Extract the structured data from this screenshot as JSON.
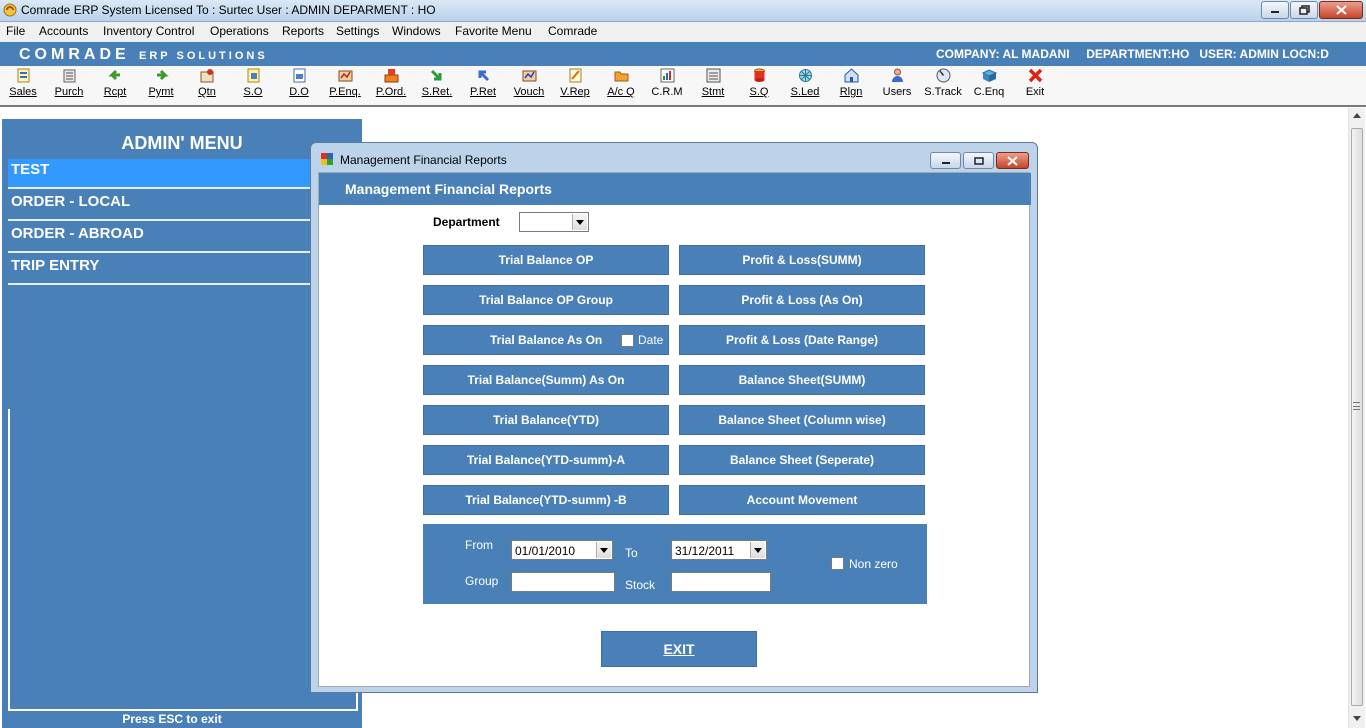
{
  "titlebar": {
    "title": "Comrade ERP System  Licensed To : Surtec  User : ADMIN  DEPARMENT : HO"
  },
  "menubar": {
    "items": [
      {
        "label": "File"
      },
      {
        "label": "Accounts"
      },
      {
        "label": "Inventory Control"
      },
      {
        "label": "Operations"
      },
      {
        "label": "Reports"
      },
      {
        "label": "Settings"
      },
      {
        "label": "Windows"
      },
      {
        "label": "Favorite Menu"
      },
      {
        "label": "Comrade"
      }
    ]
  },
  "brandbar": {
    "brand_big": "COMRADE",
    "brand_small": "ERP SOLUTIONS",
    "info": "COMPANY: AL MADANI     DEPARTMENT:HO   USER: ADMIN LOCN:D"
  },
  "toolbar": {
    "buttons": [
      {
        "label": "Sales",
        "icon": "sales-icon"
      },
      {
        "label": "Purch",
        "icon": "purchase-icon"
      },
      {
        "label": "Rcpt",
        "icon": "receipt-icon"
      },
      {
        "label": "Pymt",
        "icon": "payment-icon"
      },
      {
        "label": "Qtn",
        "icon": "quotation-icon"
      },
      {
        "label": "S.O",
        "icon": "sales-order-icon"
      },
      {
        "label": "D.O",
        "icon": "delivery-order-icon"
      },
      {
        "label": "P.Enq.",
        "icon": "purchase-enquiry-icon"
      },
      {
        "label": "P.Ord.",
        "icon": "purchase-order-icon"
      },
      {
        "label": "S.Ret.",
        "icon": "sales-return-icon"
      },
      {
        "label": "P.Ret",
        "icon": "purchase-return-icon"
      },
      {
        "label": "Vouch",
        "icon": "voucher-icon"
      },
      {
        "label": "V.Rep",
        "icon": "voucher-report-icon"
      },
      {
        "label": "A/c Q",
        "icon": "account-query-icon"
      },
      {
        "label": "C.R.M",
        "icon": "crm-icon"
      },
      {
        "label": "Stmt",
        "icon": "statement-icon"
      },
      {
        "label": "S.Q",
        "icon": "stock-query-icon"
      },
      {
        "label": "S.Led",
        "icon": "stock-ledger-icon"
      },
      {
        "label": "Rlgn",
        "icon": "relogin-icon"
      },
      {
        "label": "Users",
        "icon": "users-icon"
      },
      {
        "label": "S.Track",
        "icon": "shipment-track-icon"
      },
      {
        "label": "C.Enq",
        "icon": "customer-enquiry-icon"
      },
      {
        "label": "Exit",
        "icon": "exit-icon"
      }
    ]
  },
  "admin_menu": {
    "title": "ADMIN' MENU",
    "items": [
      {
        "label": "TEST"
      },
      {
        "label": "ORDER - LOCAL"
      },
      {
        "label": "ORDER - ABROAD"
      },
      {
        "label": "TRIP ENTRY"
      }
    ],
    "footer": "Press ESC to exit"
  },
  "dialog": {
    "window_title": "Management Financial Reports",
    "header": "Management Financial Reports",
    "department_label": "Department",
    "department_value": "",
    "left_buttons": [
      {
        "label": "Trial Balance OP"
      },
      {
        "label": "Trial Balance OP Group"
      },
      {
        "label": "Trial Balance As On"
      },
      {
        "label": "Trial Balance(Summ) As On"
      },
      {
        "label": "Trial Balance(YTD)"
      },
      {
        "label": "Trial Balance(YTD-summ)-A"
      },
      {
        "label": "Trial Balance(YTD-summ) -B"
      }
    ],
    "right_buttons": [
      {
        "label": "Profit & Loss(SUMM)"
      },
      {
        "label": "Profit & Loss (As On)"
      },
      {
        "label": "Profit & Loss (Date Range)"
      },
      {
        "label": "Balance Sheet(SUMM)"
      },
      {
        "label": "Balance Sheet (Column wise)"
      },
      {
        "label": "Balance Sheet (Seperate)"
      },
      {
        "label": "Account Movement"
      }
    ],
    "date_checkbox_label": "Date",
    "from_label": "From",
    "from_value": "01/01/2010",
    "to_label": "To",
    "to_value": "31/12/2011",
    "group_label": "Group",
    "group_value": "",
    "stock_label": "Stock",
    "stock_value": "",
    "nonzero_label": "Non zero",
    "exit_label": "EXIT"
  }
}
